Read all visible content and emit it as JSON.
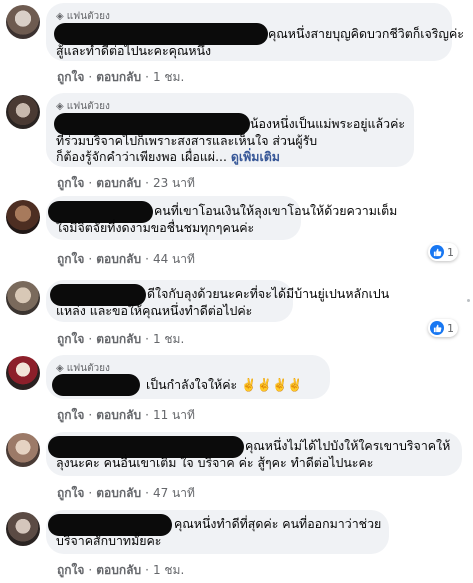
{
  "comments": [
    {
      "badge": "แฟนตัวยง",
      "text_lines": [
        "คุณหนึ่งสายบุญคิดบวกชีวิตก็เจริญค่ะ",
        "สู้และทำดีต่อไปนะคะคุณหนึ่ง"
      ],
      "like": "ถูกใจ",
      "reply": "ตอบกลับ",
      "time": "1 ชม."
    },
    {
      "badge": "แฟนตัวยง",
      "text_lines": [
        "น้องหนึ่งเป็นแม่พระอยู่แล้วค่ะ",
        "ที่ร่วมบริจาคไปก็เพราะสงสารและเห็นใจ ส่วนผู้รับ",
        "ก็ต้องรู้จักคำว่าเพียงพอ เผื่อแผ่..."
      ],
      "see_more": "ดูเพิ่มเติม",
      "like": "ถูกใจ",
      "reply": "ตอบกลับ",
      "time": "23 นาที"
    },
    {
      "text_lines": [
        "คนที่เขาโอนเงินให้ลุงเขาโอนให้ด้วยความเต็ม",
        "ใจมีจิตจัยที่งดงามขอชื่นชมทุกๆคนค่ะ"
      ],
      "like": "ถูกใจ",
      "reply": "ตอบกลับ",
      "time": "44 นาที",
      "reaction_count": "1"
    },
    {
      "text_lines": [
        "ดีใจกับลุงด้วยนะคะที่จะได้มีบ้านยู่เปนหลักเปน",
        "แหล่ง และขอให้คุณหนึ่งทำดีต่อไปค่ะ"
      ],
      "like": "ถูกใจ",
      "reply": "ตอบกลับ",
      "time": "1 ชม.",
      "reaction_count": "1"
    },
    {
      "badge": "แฟนตัวยง",
      "text_lines": [
        "เป็นกำลังใจให้ค่ะ ✌️✌️✌️✌️"
      ],
      "like": "ถูกใจ",
      "reply": "ตอบกลับ",
      "time": "11 นาที"
    },
    {
      "text_lines": [
        "คุณหนึ่งไม่ได้ไปบังให้ใครเขาบริจาคให้",
        "ลุงนะคะ คนอื่นเขาเติม ใจ บริจาค ค่ะ สู้ๆคะ ทำดีต่อไปนะคะ"
      ],
      "like": "ถูกใจ",
      "reply": "ตอบกลับ",
      "time": "47 นาที"
    },
    {
      "text_lines": [
        "คุณหนึ่งทำดีที่สุดค่ะ คนที่ออกมาว่าช่วย",
        "บริจาคสักบาทมั้ยคะ"
      ],
      "like": "ถูกใจ",
      "reply": "ตอบกลับ",
      "time": "1 ชม."
    }
  ],
  "colors": {
    "bubble": "#f0f2f5",
    "meta": "#65676b",
    "link": "#385898",
    "like": "#1877f2",
    "redaction": "#0b0b0b"
  }
}
